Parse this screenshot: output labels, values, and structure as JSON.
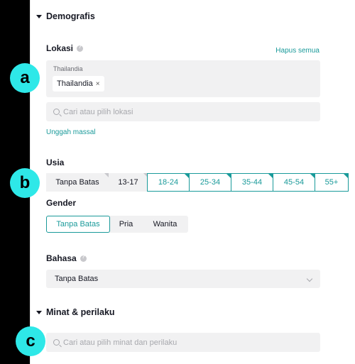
{
  "demographics": {
    "title": "Demografis",
    "location": {
      "label": "Lokasi",
      "clear_all": "Hapus semua",
      "group_name": "Thailandia",
      "chip": "Thailandia",
      "chip_remove": "×",
      "search_placeholder": "Cari atau pilih lokasi",
      "bulk_upload": "Unggah massal"
    },
    "age": {
      "label": "Usia",
      "options": [
        "Tanpa Batas",
        "13-17",
        "18-24",
        "25-34",
        "35-44",
        "45-54",
        "55+"
      ]
    },
    "gender": {
      "label": "Gender",
      "options": [
        "Tanpa Batas",
        "Pria",
        "Wanita"
      ]
    },
    "language": {
      "label": "Bahasa",
      "value": "Tanpa Batas"
    }
  },
  "interests": {
    "title": "Minat & perilaku",
    "search_placeholder": "Cari atau pilih minat dan perilaku"
  },
  "annotations": [
    "a",
    "b",
    "c"
  ],
  "colors": {
    "accent": "#1a9a9a",
    "badge": "#2ee8e8"
  }
}
